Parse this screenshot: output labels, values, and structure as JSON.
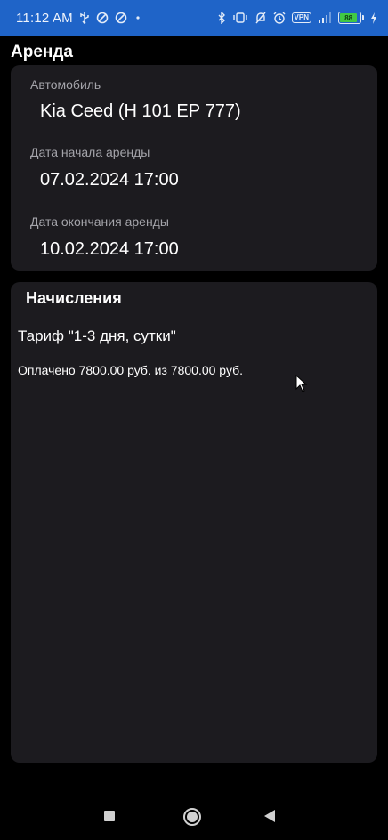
{
  "status_bar": {
    "time": "11:12 AM",
    "left_icons": [
      "usb-icon",
      "blocked-icon",
      "blocked-icon",
      "dot-icon"
    ],
    "right_icons": [
      "bluetooth-icon",
      "vibrate-icon",
      "mute-icon",
      "alarm-icon",
      "vpn-icon",
      "signal-icon",
      "battery-icon",
      "charging-icon"
    ],
    "vpn_label": "VPN",
    "battery_level": "88",
    "background_color": "#1f64c8"
  },
  "page": {
    "title": "Аренда"
  },
  "rental": {
    "car_label": "Автомобиль",
    "car_value": "Kia Ceed (Н 101 ЕР 777)",
    "start_label": "Дата начала аренды",
    "start_value": "07.02.2024 17:00",
    "end_label": "Дата окончания аренды",
    "end_value": "10.02.2024 17:00"
  },
  "charges": {
    "title": "Начисления",
    "tariff": "Тариф \"1-3 дня, сутки\"",
    "paid": "Оплачено 7800.00 руб. из 7800.00 руб."
  },
  "colors": {
    "background": "#000000",
    "card": "#1c1b1f",
    "label": "#a4a4aa",
    "text": "#ffffff"
  },
  "nav_bar": {
    "icons": [
      "recent-apps-icon",
      "home-icon",
      "back-icon"
    ]
  }
}
